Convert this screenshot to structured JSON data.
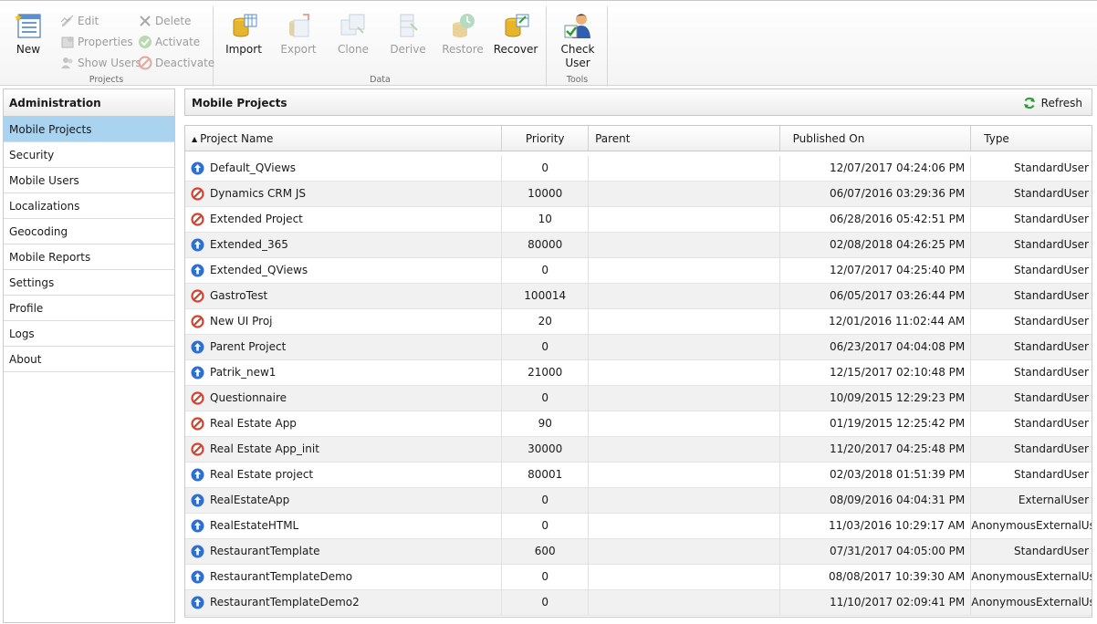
{
  "ribbon": {
    "projects": {
      "label": "Projects",
      "new": "New",
      "edit": "Edit",
      "properties": "Properties",
      "show_users": "Show Users",
      "delete": "Delete",
      "activate": "Activate",
      "deactivate": "Deactivate"
    },
    "data": {
      "label": "Data",
      "import": "Import",
      "export": "Export",
      "clone": "Clone",
      "derive": "Derive",
      "restore": "Restore",
      "recover": "Recover"
    },
    "tools": {
      "label": "Tools",
      "check_user_1": "Check",
      "check_user_2": "User"
    }
  },
  "sidebar": {
    "header": "Administration",
    "items": [
      {
        "label": "Mobile Projects",
        "active": true
      },
      {
        "label": "Security"
      },
      {
        "label": "Mobile Users"
      },
      {
        "label": "Localizations"
      },
      {
        "label": "Geocoding"
      },
      {
        "label": "Mobile Reports"
      },
      {
        "label": "Settings"
      },
      {
        "label": "Profile"
      },
      {
        "label": "Logs"
      },
      {
        "label": "About"
      }
    ]
  },
  "main": {
    "title": "Mobile Projects",
    "refresh": "Refresh",
    "columns": {
      "name": "Project Name",
      "priority": "Priority",
      "parent": "Parent",
      "published": "Published On",
      "type": "Type"
    },
    "rows": [
      {
        "status": "published",
        "name": "Default_QViews",
        "priority": "0",
        "parent": "",
        "published": "12/07/2017 04:24:06 PM",
        "type": "StandardUser"
      },
      {
        "status": "blocked",
        "name": "Dynamics CRM JS",
        "priority": "10000",
        "parent": "",
        "published": "06/07/2016 03:29:36 PM",
        "type": "StandardUser"
      },
      {
        "status": "blocked",
        "name": "Extended Project",
        "priority": "10",
        "parent": "",
        "published": "06/28/2016 05:42:51 PM",
        "type": "StandardUser"
      },
      {
        "status": "published",
        "name": "Extended_365",
        "priority": "80000",
        "parent": "",
        "published": "02/08/2018 04:26:25 PM",
        "type": "StandardUser"
      },
      {
        "status": "published",
        "name": "Extended_QViews",
        "priority": "0",
        "parent": "",
        "published": "12/07/2017 04:25:40 PM",
        "type": "StandardUser"
      },
      {
        "status": "blocked",
        "name": "GastroTest",
        "priority": "100014",
        "parent": "",
        "published": "06/05/2017 03:26:44 PM",
        "type": "StandardUser"
      },
      {
        "status": "blocked",
        "name": "New UI Proj",
        "priority": "20",
        "parent": "",
        "published": "12/01/2016 11:02:44 AM",
        "type": "StandardUser"
      },
      {
        "status": "published",
        "name": "Parent Project",
        "priority": "0",
        "parent": "",
        "published": "06/23/2017 04:04:08 PM",
        "type": "StandardUser"
      },
      {
        "status": "published",
        "name": "Patrik_new1",
        "priority": "21000",
        "parent": "",
        "published": "12/15/2017 02:10:48 PM",
        "type": "StandardUser"
      },
      {
        "status": "blocked",
        "name": "Questionnaire",
        "priority": "0",
        "parent": "",
        "published": "10/09/2015 12:29:23 PM",
        "type": "StandardUser"
      },
      {
        "status": "blocked",
        "name": "Real Estate App",
        "priority": "90",
        "parent": "",
        "published": "01/19/2015 12:25:42 PM",
        "type": "StandardUser"
      },
      {
        "status": "blocked",
        "name": "Real Estate App_init",
        "priority": "30000",
        "parent": "",
        "published": "11/20/2017 04:25:48 PM",
        "type": "StandardUser"
      },
      {
        "status": "published",
        "name": "Real Estate project",
        "priority": "80001",
        "parent": "",
        "published": "02/03/2018 01:51:39 PM",
        "type": "StandardUser"
      },
      {
        "status": "published",
        "name": "RealEstateApp",
        "priority": "0",
        "parent": "",
        "published": "08/09/2016 04:04:31 PM",
        "type": "ExternalUser"
      },
      {
        "status": "published",
        "name": "RealEstateHTML",
        "priority": "0",
        "parent": "",
        "published": "11/03/2016 10:29:17 AM",
        "type": "AnonymousExternalUser"
      },
      {
        "status": "published",
        "name": "RestaurantTemplate",
        "priority": "600",
        "parent": "",
        "published": "07/31/2017 04:05:00 PM",
        "type": "StandardUser"
      },
      {
        "status": "published",
        "name": "RestaurantTemplateDemo",
        "priority": "0",
        "parent": "",
        "published": "08/08/2017 10:39:30 AM",
        "type": "AnonymousExternalUser"
      },
      {
        "status": "published",
        "name": "RestaurantTemplateDemo2",
        "priority": "0",
        "parent": "",
        "published": "11/10/2017 02:09:41 PM",
        "type": "AnonymousExternalUser"
      }
    ]
  },
  "colors": {
    "selected": "#a9d3ee",
    "published_icon": "#2f6fd1",
    "blocked_icon": "#d9432f"
  }
}
